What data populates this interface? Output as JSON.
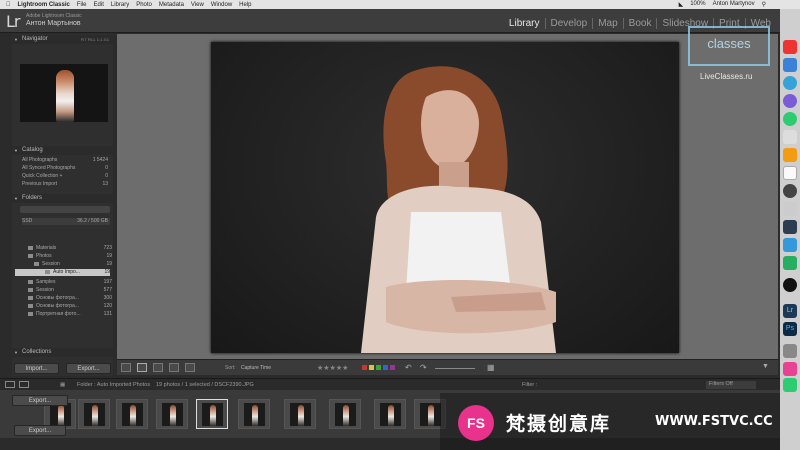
{
  "menubar": {
    "app": "Lightroom Classic",
    "items": [
      "File",
      "Edit",
      "Library",
      "Photo",
      "Metadata",
      "View",
      "Window",
      "Help"
    ],
    "battery": "100%",
    "user": "Anton Martynov"
  },
  "titlebar": {
    "app_name": "Adobe Lightroom Classic",
    "user_name": "Антон Мартынов",
    "logo": "Lr"
  },
  "modules": [
    "Library",
    "Develop",
    "Map",
    "Book",
    "Slideshow",
    "Print",
    "Web"
  ],
  "navigator": {
    "title": "Navigator",
    "zoom": [
      "FIT",
      "FILL",
      "1:1",
      "3:1"
    ]
  },
  "catalog": {
    "title": "Catalog",
    "items": [
      {
        "label": "All Photographs",
        "count": "1 5424"
      },
      {
        "label": "All Synced Photographs",
        "count": "0"
      },
      {
        "label": "Quick Collection +",
        "count": "0"
      },
      {
        "label": "Previous Import",
        "count": "13"
      }
    ]
  },
  "folders": {
    "title": "Folders",
    "volume": "SSD",
    "volume_info": "36.2 / 500 GB",
    "items": [
      {
        "label": "Materials",
        "count": "723"
      },
      {
        "label": "Photos",
        "count": "19"
      },
      {
        "label": "Session",
        "count": "19"
      },
      {
        "label": "Auto Impo...",
        "count": "19"
      },
      {
        "label": "Samples",
        "count": "197"
      },
      {
        "label": "Session",
        "count": "577"
      },
      {
        "label": "Основы фотогра...",
        "count": "300"
      },
      {
        "label": "Основы фотогра...",
        "count": "120"
      },
      {
        "label": "Портретная фото...",
        "count": "131"
      }
    ]
  },
  "collections_title": "Collections",
  "buttons": {
    "import": "Import...",
    "export": "Export...",
    "export2": "Export..."
  },
  "toolbar": {
    "sort_label": "Sort:",
    "sort_value": "Capture Time"
  },
  "filmstrip": {
    "path": "Folder : Auto Imported Photos",
    "count": "19 photos / 1 selected / DSCF2390.JPG",
    "filter_label": "Filter :",
    "filter_value": "Filters Off",
    "page": "1",
    "page2": "2"
  },
  "watermark": {
    "main": "classes",
    "sub": "LiveClasses.ru"
  },
  "brand": {
    "logo": "FS",
    "text": "梵摄创意库",
    "url": "WWW.FSTVC.CC"
  }
}
